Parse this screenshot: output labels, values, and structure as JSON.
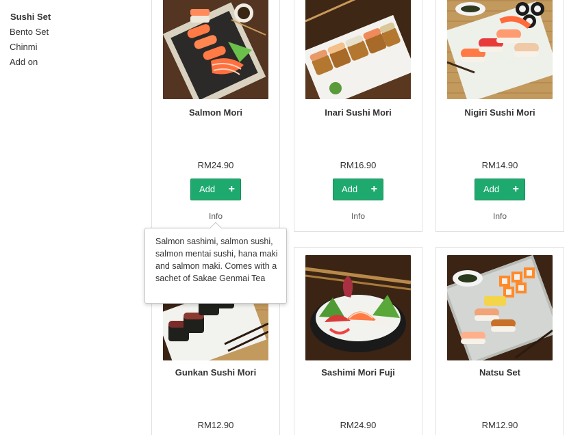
{
  "sidebar": {
    "items": [
      {
        "label": "Sushi Set"
      },
      {
        "label": "Bento Set"
      },
      {
        "label": "Chinmi"
      },
      {
        "label": "Add on"
      }
    ]
  },
  "products": [
    {
      "name": "Salmon Mori",
      "price": "RM24.90",
      "add_label": "Add",
      "info_label": "Info"
    },
    {
      "name": "Inari Sushi Mori",
      "price": "RM16.90",
      "add_label": "Add",
      "info_label": "Info"
    },
    {
      "name": "Nigiri Sushi Mori",
      "price": "RM14.90",
      "add_label": "Add",
      "info_label": "Info"
    },
    {
      "name": "Gunkan Sushi Mori",
      "price": "RM12.90"
    },
    {
      "name": "Sashimi Mori Fuji",
      "price": "RM24.90"
    },
    {
      "name": "Natsu Set",
      "price": "RM12.90"
    }
  ],
  "tooltip": {
    "text": "Salmon sashimi, salmon sushi, salmon mentai sushi, hana maki and salmon maki. Comes with a sachet of Sakae Genmai Tea"
  },
  "colors": {
    "add_button": "#1eaa6e",
    "card_border": "#e1e1e1"
  }
}
